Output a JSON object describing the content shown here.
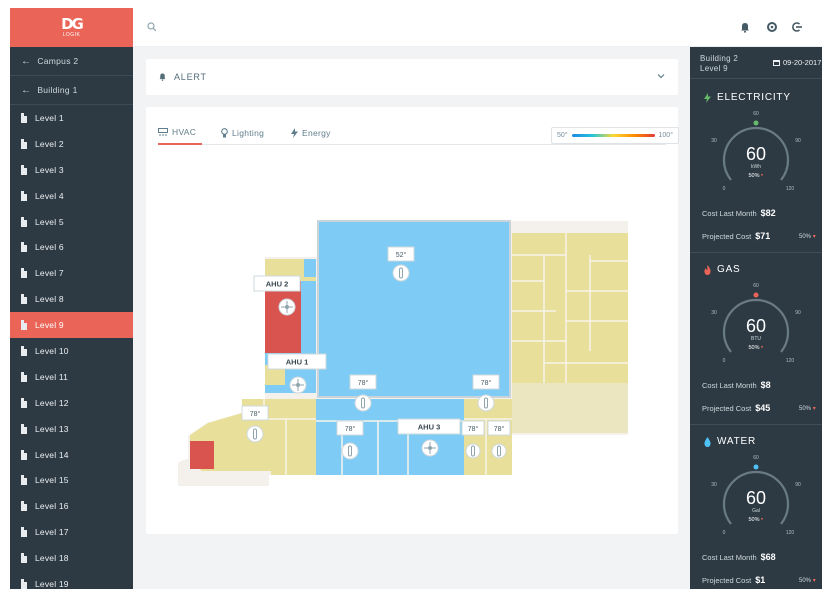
{
  "logo": {
    "mark": "DG",
    "word": "LOGIK"
  },
  "sidebar": {
    "back_campus": "Campus 2",
    "back_building": "Building 1",
    "levels": [
      "Level 1",
      "Level 2",
      "Level 3",
      "Level 4",
      "Level 5",
      "Level 6",
      "Level 7",
      "Level 8",
      "Level 9",
      "Level 10",
      "Level 11",
      "Level 12",
      "Level 13",
      "Level 14",
      "Level 15",
      "Level 16",
      "Level 17",
      "Level 18",
      "Level 19"
    ],
    "active_level": "Level 9"
  },
  "icons": {
    "search": "search-icon",
    "bell": "bell-icon",
    "settings": "gear-icon",
    "logout": "logout-icon"
  },
  "alert": {
    "label": "ALERT"
  },
  "tabs": [
    {
      "label": "HVAC",
      "icon": "hvac-icon",
      "active": true
    },
    {
      "label": "Lighting",
      "icon": "bulb-icon",
      "active": false
    },
    {
      "label": "Energy",
      "icon": "bolt-icon",
      "active": false
    }
  ],
  "scale": {
    "min": "50°",
    "max": "100°"
  },
  "floorplan": {
    "units": [
      {
        "id": "ahu2",
        "label": "AHU 2"
      },
      {
        "id": "ahu1",
        "label": "AHU 1"
      },
      {
        "id": "ahu3",
        "label": "AHU 3"
      }
    ],
    "temps": [
      {
        "id": "t-main",
        "label": "52°"
      },
      {
        "id": "t-center",
        "label": "78°"
      },
      {
        "id": "t-right",
        "label": "78°"
      },
      {
        "id": "t-left",
        "label": "78°"
      },
      {
        "id": "t-lower",
        "label": "78°"
      },
      {
        "id": "t-br1",
        "label": "78°"
      },
      {
        "id": "t-br2",
        "label": "78°"
      }
    ],
    "colors": {
      "cool": "#7ecbf5",
      "warm": "#e8df9a",
      "hot": "#d9534f"
    }
  },
  "right_panel": {
    "building": "Building 2",
    "level": "Level 9",
    "date": "09-20-2017",
    "utilities": [
      {
        "name": "ELECTRICITY",
        "icon": "bolt-icon",
        "accent": "#66bb6a",
        "value": "60",
        "unit": "kWh",
        "change": "50%",
        "ticks": [
          "0",
          "30",
          "60",
          "90",
          "120"
        ],
        "cost_last_label": "Cost Last Month",
        "cost_last": "$82",
        "projected_label": "Projected Cost",
        "projected": "$71",
        "projected_change": "50%"
      },
      {
        "name": "GAS",
        "icon": "flame-icon",
        "accent": "#ea6457",
        "value": "60",
        "unit": "BTU",
        "change": "50%",
        "ticks": [
          "0",
          "30",
          "60",
          "90",
          "120"
        ],
        "cost_last_label": "Cost Last Month",
        "cost_last": "$8",
        "projected_label": "Projected Cost",
        "projected": "$45",
        "projected_change": "50%"
      },
      {
        "name": "WATER",
        "icon": "drop-icon",
        "accent": "#4fc3f7",
        "value": "60",
        "unit": "Gal",
        "change": "50%",
        "ticks": [
          "0",
          "30",
          "60",
          "90",
          "120"
        ],
        "cost_last_label": "Cost Last Month",
        "cost_last": "$68",
        "projected_label": "Projected Cost",
        "projected": "$1",
        "projected_change": "50%"
      }
    ]
  }
}
